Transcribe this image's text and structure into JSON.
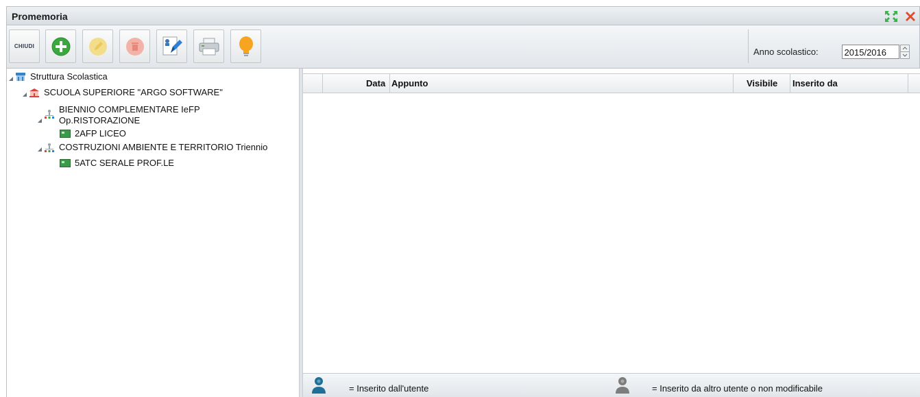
{
  "window": {
    "title": "Promemoria",
    "colors": {
      "maximize": "#3cb04a",
      "close": "#e04a2f"
    }
  },
  "toolbar": {
    "close_label": "CHIUDI",
    "buttons": [
      {
        "icon": "add-icon",
        "enabled": true
      },
      {
        "icon": "edit-icon",
        "enabled": false
      },
      {
        "icon": "delete-icon",
        "enabled": false
      },
      {
        "icon": "user-edit-icon",
        "enabled": true
      },
      {
        "icon": "printer-icon",
        "enabled": true
      },
      {
        "icon": "lightbulb-icon",
        "enabled": true
      }
    ],
    "school_year_label": "Anno scolastico:",
    "school_year_value": "2015/2016"
  },
  "tree": {
    "nodes": [
      {
        "label": "Struttura Scolastica",
        "icon": "institution-icon"
      },
      {
        "label": "SCUOLA SUPERIORE \"ARGO SOFTWARE\"",
        "icon": "school-icon"
      },
      {
        "label": "BIENNIO COMPLEMENTARE IeFP\nOp.RISTORAZIONE",
        "icon": "course-icon"
      },
      {
        "label": "2AFP LICEO",
        "icon": "class-icon"
      },
      {
        "label": "COSTRUZIONI AMBIENTE E TERRITORIO Triennio",
        "icon": "course-icon"
      },
      {
        "label": "5ATC SERALE PROF.LE",
        "icon": "class-icon"
      }
    ]
  },
  "grid": {
    "columns": [
      "Data",
      "Appunto",
      "Visibile",
      "Inserito da"
    ],
    "rows": []
  },
  "legend": {
    "own_label": "= Inserito dall'utente",
    "other_label": "= Inserito da altro utente o non modificabile",
    "colors": {
      "own": "#1f6f96",
      "other": "#7d7d7d"
    }
  }
}
